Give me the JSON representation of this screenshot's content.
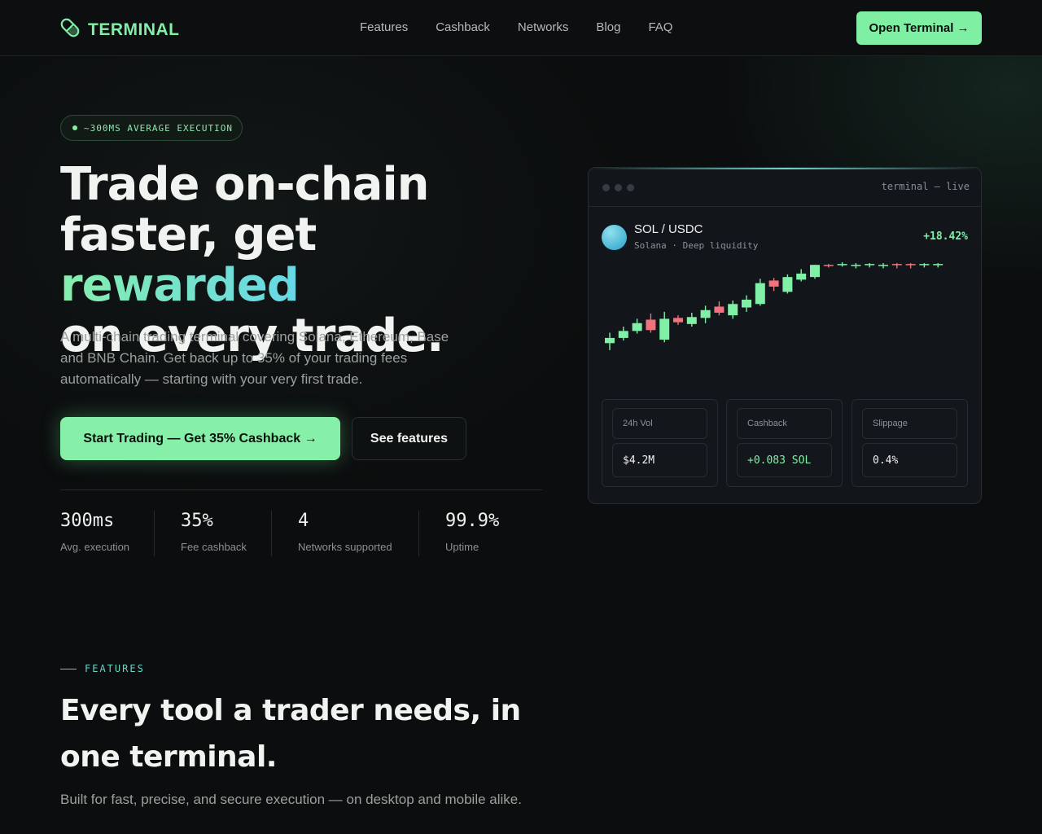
{
  "nav": {
    "brand": "TERMINAL",
    "links": [
      "Features",
      "Cashback",
      "Networks",
      "Blog",
      "FAQ"
    ],
    "cta": "Open Terminal →"
  },
  "hero": {
    "badge": "~300MS AVERAGE EXECUTION",
    "title_line1": "Trade on-chain",
    "title_line2_a": "faster, get ",
    "title_line2_accent": "rewarded",
    "title_line3": "on every trade.",
    "subtitle": "A multi-chain trading terminal covering Solana, Ethereum, Base and BNB Chain. Get back up to 35% of your trading fees automatically — starting with your very first trade.",
    "primary_cta": "Start Trading — Get 35% Cashback →",
    "secondary_cta": "See features"
  },
  "stats": [
    {
      "value": "300ms",
      "label": "Avg. execution"
    },
    {
      "value": "35%",
      "label": "Fee cashback"
    },
    {
      "value": "4",
      "label": "Networks supported"
    },
    {
      "value": "99.9%",
      "label": "Uptime"
    }
  ],
  "terminal": {
    "header_label": "terminal — live",
    "pair": "SOL / USDC",
    "pair_sub": "Solana · Deep liquidity",
    "change": "+18.42%",
    "metrics": [
      {
        "label": "24h Vol",
        "value": "$4.2M"
      },
      {
        "label": "Cashback",
        "value": "+0.083 SOL"
      },
      {
        "label": "Slippage",
        "value": "0.4%"
      }
    ]
  },
  "chart_data": {
    "type": "candlestick",
    "colors": {
      "up": "#7ff0a6",
      "down": "#f0727f"
    },
    "candles": [
      {
        "o": 10,
        "c": 16,
        "h": 22,
        "l": 2
      },
      {
        "o": 16,
        "c": 24,
        "h": 29,
        "l": 13
      },
      {
        "o": 24,
        "c": 33,
        "h": 38,
        "l": 21
      },
      {
        "o": 37,
        "c": 25,
        "h": 44,
        "l": 22
      },
      {
        "o": 14,
        "c": 38,
        "h": 46,
        "l": 11
      },
      {
        "o": 39,
        "c": 34,
        "h": 42,
        "l": 31
      },
      {
        "o": 32,
        "c": 40,
        "h": 45,
        "l": 29
      },
      {
        "o": 39,
        "c": 48,
        "h": 53,
        "l": 33
      },
      {
        "o": 52,
        "c": 45,
        "h": 58,
        "l": 42
      },
      {
        "o": 42,
        "c": 55,
        "h": 59,
        "l": 38
      },
      {
        "o": 51,
        "c": 60,
        "h": 65,
        "l": 46
      },
      {
        "o": 55,
        "c": 79,
        "h": 84,
        "l": 53
      },
      {
        "o": 82,
        "c": 75,
        "h": 85,
        "l": 70
      },
      {
        "o": 69,
        "c": 86,
        "h": 89,
        "l": 67
      },
      {
        "o": 83,
        "c": 90,
        "h": 95,
        "l": 81
      },
      {
        "o": 86,
        "c": 100,
        "h": 100,
        "l": 84
      },
      {
        "o": 100,
        "c": 99,
        "h": 101,
        "l": 97
      },
      {
        "o": 100,
        "c": 101,
        "h": 103,
        "l": 98
      },
      {
        "o": 99,
        "c": 100,
        "h": 102,
        "l": 96
      },
      {
        "o": 100,
        "c": 101,
        "h": 102,
        "l": 97
      },
      {
        "o": 99,
        "c": 100,
        "h": 102,
        "l": 96
      },
      {
        "o": 101,
        "c": 100,
        "h": 102,
        "l": 96
      },
      {
        "o": 101,
        "c": 100,
        "h": 102,
        "l": 96
      },
      {
        "o": 100,
        "c": 101,
        "h": 102,
        "l": 97
      },
      {
        "o": 100,
        "c": 101,
        "h": 102,
        "l": 97
      }
    ]
  },
  "features": {
    "eyebrow": "FEATURES",
    "title": "Every tool a trader needs, in one terminal.",
    "subtitle": "Built for fast, precise, and secure execution — on desktop and mobile alike."
  }
}
